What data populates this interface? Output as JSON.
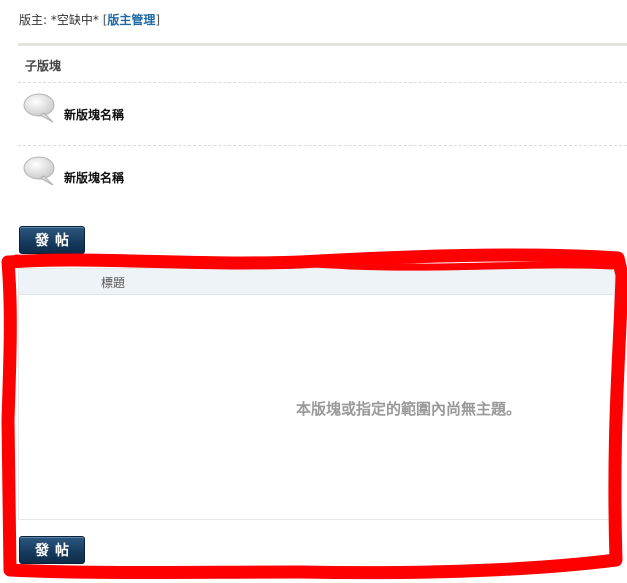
{
  "moderator": {
    "label": "版主: *空缺中*",
    "bracket_open": "[",
    "manage_link": "版主管理",
    "bracket_close": "]"
  },
  "subforums": {
    "header": "子版塊",
    "items": [
      {
        "name": "新版塊名稱",
        "icon": "speech-bubble-icon"
      },
      {
        "name": "新版塊名稱",
        "icon": "speech-bubble-icon"
      }
    ]
  },
  "toolbar": {
    "post_label": "發帖"
  },
  "threads": {
    "column_title": "標題",
    "empty_message": "本版塊或指定的範圍內尚無主題。"
  },
  "colors": {
    "button": "#173c5f",
    "link": "#1f6aa5",
    "annotation": "#ff0000",
    "table_header": "#eef3f8"
  }
}
